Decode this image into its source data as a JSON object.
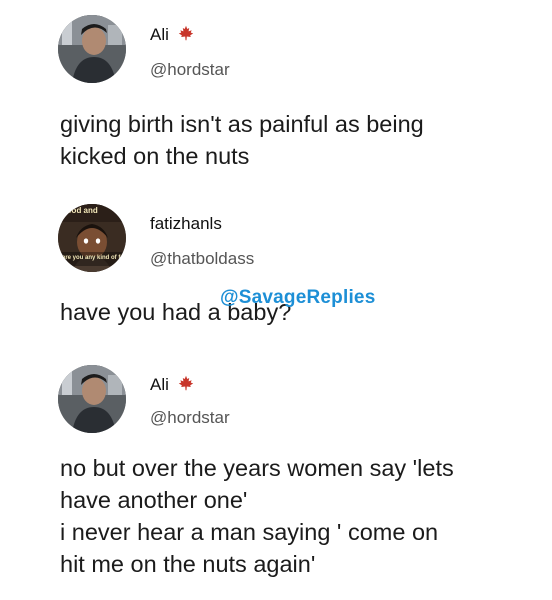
{
  "tweets": [
    {
      "name": "Ali",
      "handle": "@hordstar",
      "lines": [
        "giving birth isn't as painful as being",
        "kicked on the nuts"
      ],
      "verified_icon": "maple-leaf-icon"
    },
    {
      "name": "fatizhanls",
      "handle": "@thatboldass",
      "lines": [
        "have you had a baby?"
      ],
      "avatar_top_caption": "food and",
      "avatar_bottom_caption": "are you any kind of fo"
    },
    {
      "name": "Ali",
      "handle": "@hordstar",
      "lines": [
        "no but over the years women say 'lets",
        "have another one'",
        "i never hear a man saying ' come on",
        "hit me on the nuts again'"
      ],
      "verified_icon": "maple-leaf-icon"
    }
  ],
  "watermark": "@SavageReplies",
  "colors": {
    "leaf": "#c8362b",
    "watermark": "#1d8fd6",
    "handle": "#555555"
  }
}
